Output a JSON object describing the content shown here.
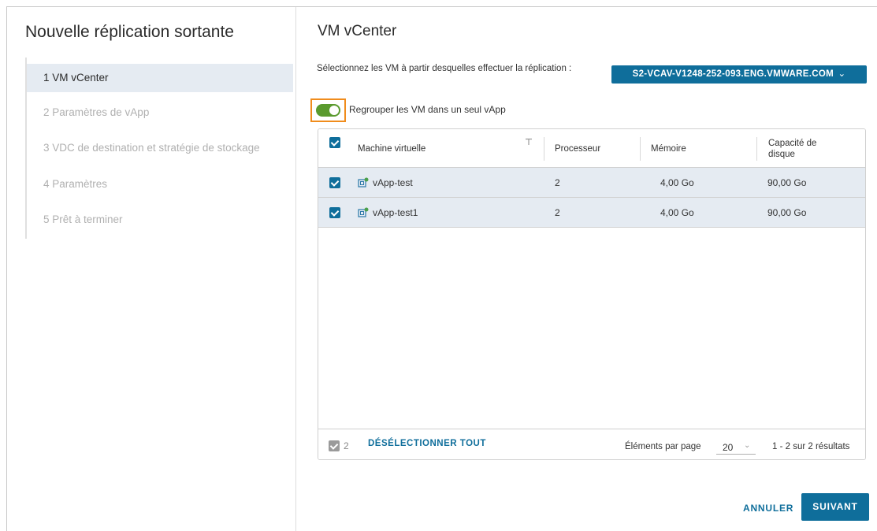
{
  "wizard": {
    "title": "Nouvelle réplication sortante",
    "steps": [
      {
        "label": "1  VM vCenter",
        "active": true
      },
      {
        "label": "2  Paramètres de vApp",
        "active": false
      },
      {
        "label": "3  VDC de destination et stratégie de stockage",
        "active": false
      },
      {
        "label": "4  Paramètres",
        "active": false
      },
      {
        "label": "5  Prêt à terminer",
        "active": false
      }
    ]
  },
  "main": {
    "title": "VM vCenter",
    "intro": "Sélectionnez les VM à partir desquelles effectuer la réplication :",
    "vcenter_button": "S2-VCAV-V1248-252-093.ENG.VMWARE.COM",
    "vcenter_chevron": "⌄",
    "group_toggle": {
      "label": "Regrouper les VM dans un seul vApp",
      "on": true
    }
  },
  "grid": {
    "columns": [
      "Machine virtuelle",
      "Processeur",
      "Mémoire",
      "Capacité de disque"
    ],
    "rows": [
      {
        "name": "vApp-test",
        "cpu": "2",
        "memory": "4,00 Go",
        "disk": "90,00 Go",
        "selected": true
      },
      {
        "name": "vApp-test1",
        "cpu": "2",
        "memory": "4,00 Go",
        "disk": "90,00 Go",
        "selected": true
      }
    ],
    "footer": {
      "selected_count": "2",
      "deselect_all": "DÉSÉLECTIONNER TOUT",
      "per_page_label": "Éléments par page",
      "per_page_value": "20",
      "results": "1 - 2 sur 2 résultats"
    }
  },
  "actions": {
    "cancel": "ANNULER",
    "next": "SUIVANT"
  },
  "colors": {
    "primary": "#0f6e9b",
    "toggle_on": "#5a9a2e",
    "highlight": "#f08c1c",
    "row_selected": "#e5ebf2"
  }
}
